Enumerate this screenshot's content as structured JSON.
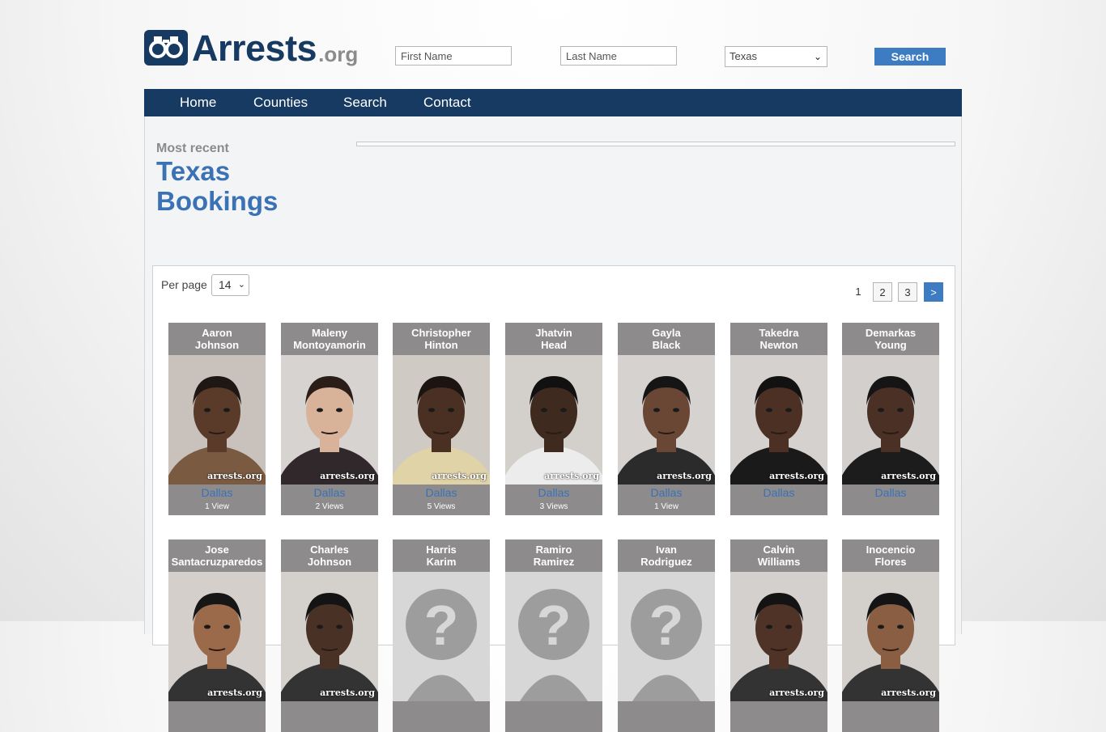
{
  "header": {
    "logo_word": "Arrests",
    "logo_tld": ".org",
    "first_name_placeholder": "First Name",
    "last_name_placeholder": "Last Name",
    "state_selected": "Texas",
    "search_label": "Search"
  },
  "nav": {
    "items": [
      "Home",
      "Counties",
      "Search",
      "Contact"
    ]
  },
  "page": {
    "kicker": "Most recent",
    "title": "Texas Bookings"
  },
  "listing": {
    "per_page_label": "Per page",
    "per_page_value": "14",
    "pages": [
      "1",
      "2",
      "3"
    ],
    "next_label": ">",
    "current_page": "1"
  },
  "watermark": "arrests.org",
  "bookings": [
    {
      "first": "Aaron",
      "last": "Johnson",
      "county": "Dallas",
      "views": "1 View",
      "photo": "mugshot",
      "skin": "#5a3a28",
      "bg": "#c9c2bc",
      "hair": "#1e1713",
      "shirt": "#7a5a40"
    },
    {
      "first": "Maleny",
      "last": "Montoyamorin",
      "county": "Dallas",
      "views": "2 Views",
      "photo": "mugshot",
      "skin": "#d8b39a",
      "bg": "#d7d3d0",
      "hair": "#2b1d17",
      "shirt": "#30282a"
    },
    {
      "first": "Christopher",
      "last": "Hinton",
      "county": "Dallas",
      "views": "5 Views",
      "photo": "mugshot",
      "skin": "#4a3022",
      "bg": "#cfcac3",
      "hair": "#1b1410",
      "shirt": "#e0d3a8"
    },
    {
      "first": "Jhatvin",
      "last": "Head",
      "county": "Dallas",
      "views": "3 Views",
      "photo": "mugshot",
      "skin": "#3f2a1f",
      "bg": "#d3d0cc",
      "hair": "#111111",
      "shirt": "#ececec"
    },
    {
      "first": "Gayla",
      "last": "Black",
      "county": "Dallas",
      "views": "1 View",
      "photo": "mugshot",
      "skin": "#6a4634",
      "bg": "#d6d2cf",
      "hair": "#151515",
      "shirt": "#2b2b2b"
    },
    {
      "first": "Takedra",
      "last": "Newton",
      "county": "Dallas",
      "views": "",
      "photo": "mugshot",
      "skin": "#4d3024",
      "bg": "#d4d1cf",
      "hair": "#121212",
      "shirt": "#1a1a1a"
    },
    {
      "first": "Demarkas",
      "last": "Young",
      "county": "Dallas",
      "views": "",
      "photo": "mugshot",
      "skin": "#4a3025",
      "bg": "#d2cfcc",
      "hair": "#151515",
      "shirt": "#1c1c1c"
    },
    {
      "first": "Jose",
      "last": "Santacruzparedos",
      "county": "",
      "views": "",
      "photo": "mugshot",
      "skin": "#9a6a4a",
      "bg": "#d4cfca",
      "hair": "#161616",
      "shirt": "#333333"
    },
    {
      "first": "Charles",
      "last": "Johnson",
      "county": "",
      "views": "",
      "photo": "mugshot",
      "skin": "#4a3125",
      "bg": "#d4d0cc",
      "hair": "#141414",
      "shirt": "#333333"
    },
    {
      "first": "Harris",
      "last": "Karim",
      "county": "",
      "views": "",
      "photo": "placeholder",
      "skin": "",
      "bg": "#d7d7d7",
      "hair": "",
      "shirt": ""
    },
    {
      "first": "Ramiro",
      "last": "Ramirez",
      "county": "",
      "views": "",
      "photo": "placeholder",
      "skin": "",
      "bg": "#d7d7d7",
      "hair": "",
      "shirt": ""
    },
    {
      "first": "Ivan",
      "last": "Rodriguez",
      "county": "",
      "views": "",
      "photo": "placeholder",
      "skin": "",
      "bg": "#d7d7d7",
      "hair": "",
      "shirt": ""
    },
    {
      "first": "Calvin",
      "last": "Williams",
      "county": "",
      "views": "",
      "photo": "mugshot",
      "skin": "#4f3326",
      "bg": "#d3d0cd",
      "hair": "#131313",
      "shirt": "#333333"
    },
    {
      "first": "Inocencio",
      "last": "Flores",
      "county": "",
      "views": "",
      "photo": "mugshot",
      "skin": "#8a5e42",
      "bg": "#d3cfcb",
      "hair": "#141414",
      "shirt": "#333333"
    }
  ]
}
